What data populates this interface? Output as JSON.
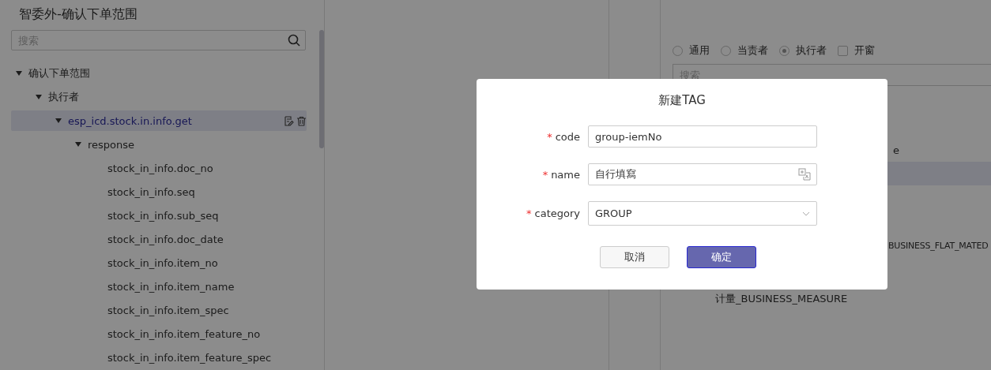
{
  "left_panel": {
    "title": "智委外-确认下单范围",
    "search": {
      "placeholder": "搜索"
    },
    "tree": [
      {
        "label": "确认下单范围",
        "expanded": true,
        "selected": false,
        "children": [
          {
            "label": "执行者",
            "expanded": true,
            "selected": false,
            "children": [
              {
                "label": "esp_icd.stock.in.info.get",
                "expanded": true,
                "selected": true,
                "children": [
                  {
                    "label": "response",
                    "expanded": true,
                    "selected": false,
                    "children": [
                      {
                        "label": "stock_in_info.doc_no",
                        "selected": false
                      },
                      {
                        "label": "stock_in_info.seq",
                        "selected": false
                      },
                      {
                        "label": "stock_in_info.sub_seq",
                        "selected": false
                      },
                      {
                        "label": "stock_in_info.doc_date",
                        "selected": false
                      },
                      {
                        "label": "stock_in_info.item_no",
                        "selected": false
                      },
                      {
                        "label": "stock_in_info.item_name",
                        "selected": false
                      },
                      {
                        "label": "stock_in_info.item_spec",
                        "selected": false
                      },
                      {
                        "label": "stock_in_info.item_feature_no",
                        "selected": false
                      },
                      {
                        "label": "stock_in_info.item_feature_spec",
                        "selected": false
                      }
                    ]
                  }
                ]
              }
            ]
          }
        ]
      }
    ]
  },
  "right_panel": {
    "options": [
      {
        "kind": "radio",
        "label": "通用",
        "selected": false
      },
      {
        "kind": "radio",
        "label": "当责者",
        "selected": false
      },
      {
        "kind": "radio",
        "label": "执行者",
        "selected": true
      },
      {
        "kind": "checkbox",
        "label": "开窗",
        "checked": false
      }
    ],
    "search": {
      "placeholder": "搜索"
    },
    "list": [
      {
        "label": "e",
        "selected": false
      },
      {
        "selected": true
      },
      {
        "label": "BUSINESS_FLAT_MATED",
        "selected": false
      },
      {
        "label": "计量_BUSINESS_MEASURE",
        "selected": false
      }
    ]
  },
  "dialog": {
    "title": "新建TAG",
    "fields": [
      {
        "kind": "text",
        "label": "code",
        "required": true,
        "required_mark": "*",
        "value": "group-iemNo"
      },
      {
        "kind": "translate",
        "label": "name",
        "required": true,
        "required_mark": "*",
        "value": "自行填寫"
      },
      {
        "kind": "select",
        "label": "category",
        "required": true,
        "required_mark": "*",
        "value": "GROUP"
      }
    ],
    "buttons": [
      {
        "label": "取消",
        "primary": false
      },
      {
        "label": "确定",
        "primary": true
      }
    ]
  }
}
